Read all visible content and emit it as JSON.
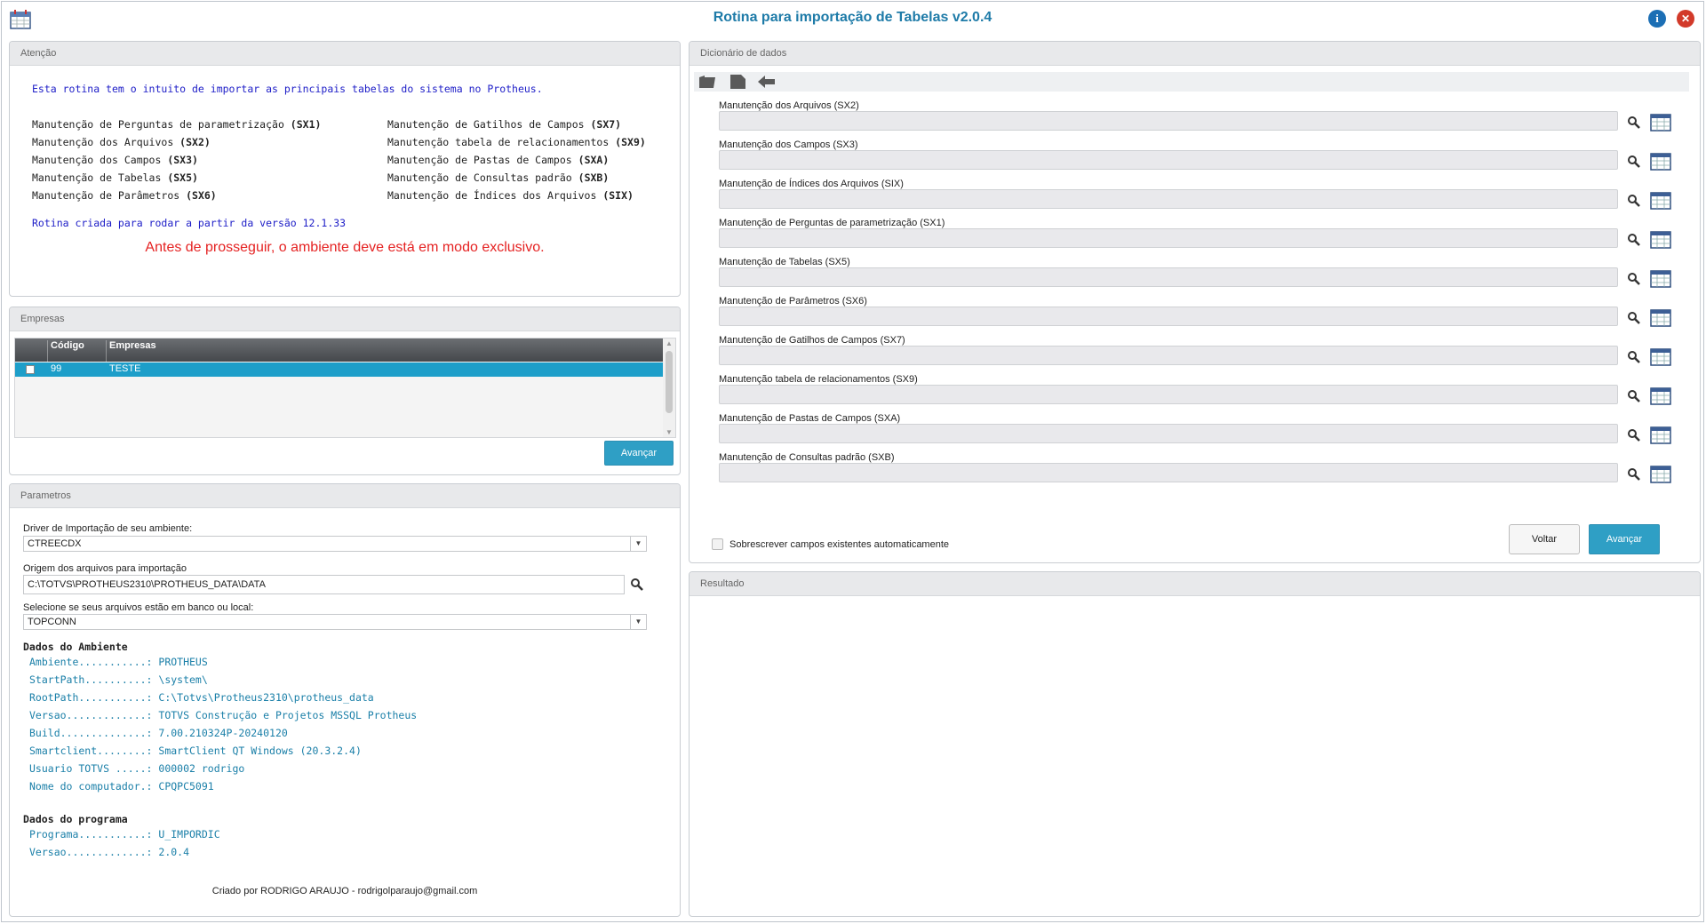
{
  "window": {
    "title": "Rotina para importação de Tabelas v2.0.4",
    "info_label": "i",
    "close_label": "✕"
  },
  "atencao": {
    "header": "Atenção",
    "intro": "Esta rotina tem o intuito de importar as principais tabelas do sistema no Protheus.",
    "left_items": [
      {
        "text": "Manutenção de Perguntas de parametrização ",
        "code": "(SX1)"
      },
      {
        "text": "Manutenção dos Arquivos ",
        "code": "(SX2)"
      },
      {
        "text": "Manutenção dos Campos ",
        "code": "(SX3)"
      },
      {
        "text": "Manutenção de Tabelas ",
        "code": "(SX5)"
      },
      {
        "text": "Manutenção de Parâmetros ",
        "code": "(SX6)"
      }
    ],
    "right_items": [
      {
        "text": "Manutenção de Gatilhos de Campos ",
        "code": "(SX7)"
      },
      {
        "text": "Manutenção tabela de relacionamentos ",
        "code": "(SX9)"
      },
      {
        "text": "Manutenção de Pastas de Campos ",
        "code": "(SXA)"
      },
      {
        "text": "Manutenção de Consultas padrão ",
        "code": "(SXB)"
      },
      {
        "text": "Manutenção de Índices dos Arquivos ",
        "code": "(SIX)"
      }
    ],
    "version_note": "Rotina criada para rodar a partir da versão 12.1.33",
    "warning": "Antes de prosseguir, o ambiente deve está em modo exclusivo."
  },
  "empresas": {
    "header": "Empresas",
    "columns": [
      "Código",
      "Empresas"
    ],
    "rows": [
      {
        "codigo": "99",
        "empresa": "TESTE",
        "selected": true
      }
    ],
    "next_label": "Avançar"
  },
  "parametros": {
    "header": "Parametros",
    "driver_label": "Driver de Importação de seu ambiente:",
    "driver_value": "CTREECDX",
    "origem_label": "Origem dos arquivos para importação",
    "origem_value": "C:\\TOTVS\\PROTHEUS2310\\PROTHEUS_DATA\\DATA",
    "local_label": "Selecione se seus arquivos estão em banco ou local:",
    "local_value": "TOPCONN",
    "ambiente_title": "Dados do Ambiente",
    "ambiente_lines": [
      "Ambiente...........: PROTHEUS",
      "StartPath..........: \\system\\",
      "RootPath...........: C:\\Totvs\\Protheus2310\\protheus_data",
      "Versao.............: TOTVS Construção e Projetos MSSQL Protheus",
      "Build..............: 7.00.210324P-20240120",
      "Smartclient........: SmartClient QT Windows (20.3.2.4)",
      "Usuario TOTVS .....: 000002 rodrigo",
      "Nome do computador.: CPQPC5091"
    ],
    "programa_title": "Dados do programa",
    "programa_lines": [
      "Programa...........: U_IMPORDIC",
      "Versao.............: 2.0.4"
    ],
    "credit": "Criado por RODRIGO ARAUJO - rodrigolparaujo@gmail.com"
  },
  "dicionario": {
    "header": "Dicionário de dados",
    "toolbar_icons": [
      "open-folder-icon",
      "save-icon",
      "back-arrow-icon"
    ],
    "fields": [
      {
        "label": "Manutenção dos Arquivos (SX2)",
        "value": ""
      },
      {
        "label": "Manutenção dos Campos (SX3)",
        "value": ""
      },
      {
        "label": "Manutenção de Índices dos Arquivos (SIX)",
        "value": ""
      },
      {
        "label": "Manutenção de Perguntas de parametrização (SX1)",
        "value": ""
      },
      {
        "label": "Manutenção de Tabelas (SX5)",
        "value": ""
      },
      {
        "label": "Manutenção de Parâmetros (SX6)",
        "value": ""
      },
      {
        "label": "Manutenção de Gatilhos de Campos (SX7)",
        "value": ""
      },
      {
        "label": "Manutenção tabela de relacionamentos (SX9)",
        "value": ""
      },
      {
        "label": "Manutenção de Pastas de Campos (SXA)",
        "value": ""
      },
      {
        "label": "Manutenção de Consultas padrão (SXB)",
        "value": ""
      }
    ],
    "overwrite_label": "Sobrescrever campos existentes automaticamente",
    "back_label": "Voltar",
    "next_label": "Avançar"
  },
  "resultado": {
    "header": "Resultado"
  },
  "colors": {
    "accent": "#2f9fc5",
    "title": "#1e7ba8",
    "warning": "#e52222",
    "intro_text": "#2020c8",
    "env_text": "#1a7fa8",
    "selected_row": "#1d9ec9"
  }
}
